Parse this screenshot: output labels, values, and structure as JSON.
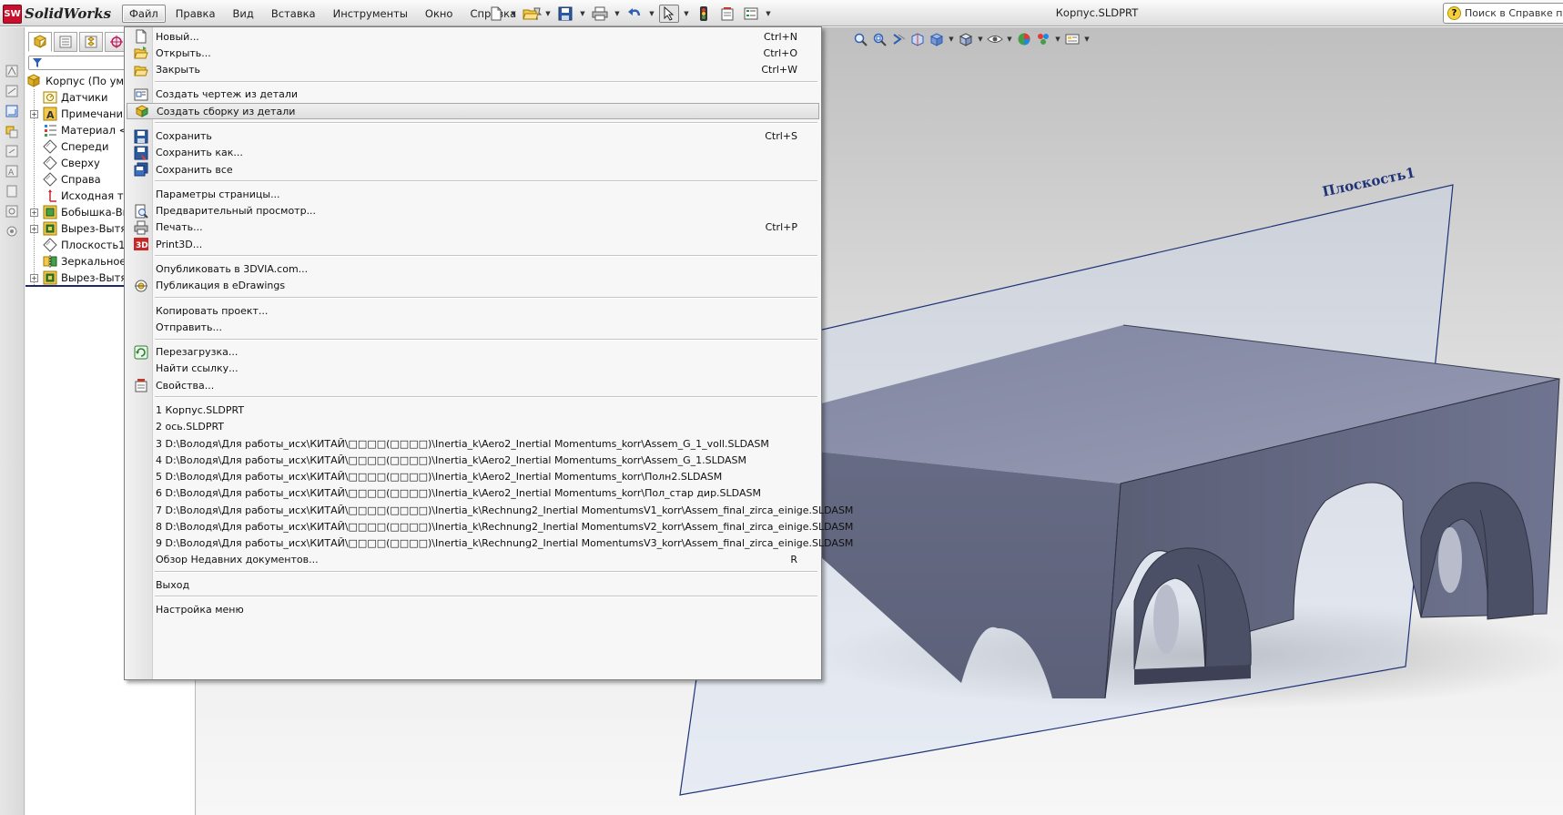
{
  "app": {
    "logo_text": "SolidWorks",
    "logo_mark": "SW",
    "document_title": "Корпус.SLDPRT",
    "help_search_placeholder": "Поиск в Справке по S"
  },
  "menubar": {
    "items": [
      "Файл",
      "Правка",
      "Вид",
      "Вставка",
      "Инструменты",
      "Окно",
      "Справка"
    ],
    "active": "Файл"
  },
  "feature_tree": {
    "root": "Корпус  (По умолч",
    "items": [
      {
        "label": "Датчики",
        "icon": "sensors-icon",
        "expandable": false
      },
      {
        "label": "Примечания",
        "icon": "annotations-icon",
        "expandable": true
      },
      {
        "label": "Материал <н",
        "icon": "material-icon",
        "expandable": false
      },
      {
        "label": "Спереди",
        "icon": "plane-icon",
        "expandable": false
      },
      {
        "label": "Сверху",
        "icon": "plane-icon",
        "expandable": false
      },
      {
        "label": "Справа",
        "icon": "plane-icon",
        "expandable": false
      },
      {
        "label": "Исходная точ",
        "icon": "origin-icon",
        "expandable": false
      },
      {
        "label": "Бобышка-Выт",
        "icon": "boss-extrude-icon",
        "expandable": true
      },
      {
        "label": "Вырез-Вытян",
        "icon": "cut-extrude-icon",
        "expandable": true
      },
      {
        "label": "Плоскость1",
        "icon": "plane-icon",
        "expandable": false
      },
      {
        "label": "Зеркальное о",
        "icon": "mirror-icon",
        "expandable": false
      },
      {
        "label": "Вырез-Вытян",
        "icon": "cut-extrude-icon",
        "expandable": true
      }
    ]
  },
  "graphics": {
    "plane_label": "Плоскость1"
  },
  "file_menu": {
    "items": [
      {
        "label": "Новый...",
        "shortcut": "Ctrl+N",
        "icon": "new-document-icon"
      },
      {
        "label": "Открыть...",
        "shortcut": "Ctrl+O",
        "icon": "open-folder-icon"
      },
      {
        "label": "Закрыть",
        "shortcut": "Ctrl+W",
        "icon": "close-folder-icon"
      },
      {
        "sep": true
      },
      {
        "label": "Создать чертеж из детали",
        "shortcut": "",
        "icon": "make-drawing-icon"
      },
      {
        "label": "Создать сборку из детали",
        "shortcut": "",
        "icon": "make-assembly-icon",
        "hover": true
      },
      {
        "sep": true
      },
      {
        "label": "Сохранить",
        "shortcut": "Ctrl+S",
        "icon": "save-icon"
      },
      {
        "label": "Сохранить как...",
        "shortcut": "",
        "icon": "save-as-icon"
      },
      {
        "label": "Сохранить все",
        "shortcut": "",
        "icon": "save-all-icon"
      },
      {
        "sep": true
      },
      {
        "label": "Параметры страницы...",
        "shortcut": "",
        "icon": ""
      },
      {
        "label": "Предварительный просмотр...",
        "shortcut": "",
        "icon": "print-preview-icon"
      },
      {
        "label": "Печать...",
        "shortcut": "Ctrl+P",
        "icon": "print-icon"
      },
      {
        "label": "Print3D...",
        "shortcut": "",
        "icon": "print3d-icon"
      },
      {
        "sep": true
      },
      {
        "label": "Опубликовать в 3DVIA.com...",
        "shortcut": "",
        "icon": ""
      },
      {
        "label": "Публикация в eDrawings",
        "shortcut": "",
        "icon": "edrawings-icon"
      },
      {
        "sep": true
      },
      {
        "label": "Копировать проект...",
        "shortcut": "",
        "icon": ""
      },
      {
        "label": "Отправить...",
        "shortcut": "",
        "icon": ""
      },
      {
        "sep": true
      },
      {
        "label": "Перезагрузка...",
        "shortcut": "",
        "icon": "reload-icon"
      },
      {
        "label": "Найти ссылку...",
        "shortcut": "",
        "icon": ""
      },
      {
        "label": "Свойства...",
        "shortcut": "",
        "icon": "properties-icon"
      },
      {
        "sep": true
      },
      {
        "label": "1 Корпус.SLDPRT",
        "shortcut": "",
        "icon": ""
      },
      {
        "label": "2 ось.SLDPRT",
        "shortcut": "",
        "icon": ""
      },
      {
        "label": "3 D:\\Володя\\Для работы_исх\\КИТАЙ\\□□□□(□□□□)\\Inertia_k\\Aero2_Inertial Momentums_korr\\Assem_G_1_voll.SLDASM",
        "shortcut": "",
        "icon": ""
      },
      {
        "label": "4 D:\\Володя\\Для работы_исх\\КИТАЙ\\□□□□(□□□□)\\Inertia_k\\Aero2_Inertial Momentums_korr\\Assem_G_1.SLDASM",
        "shortcut": "",
        "icon": ""
      },
      {
        "label": "5 D:\\Володя\\Для работы_исх\\КИТАЙ\\□□□□(□□□□)\\Inertia_k\\Aero2_Inertial Momentums_korr\\Полн2.SLDASM",
        "shortcut": "",
        "icon": ""
      },
      {
        "label": "6 D:\\Володя\\Для работы_исх\\КИТАЙ\\□□□□(□□□□)\\Inertia_k\\Aero2_Inertial Momentums_korr\\Пол_стар дир.SLDASM",
        "shortcut": "",
        "icon": ""
      },
      {
        "label": "7 D:\\Володя\\Для работы_исх\\КИТАЙ\\□□□□(□□□□)\\Inertia_k\\Rechnung2_Inertial MomentumsV1_korr\\Assem_final_zirca_einige.SLDASM",
        "shortcut": "",
        "icon": ""
      },
      {
        "label": "8 D:\\Володя\\Для работы_исх\\КИТАЙ\\□□□□(□□□□)\\Inertia_k\\Rechnung2_Inertial MomentumsV2_korr\\Assem_final_zirca_einige.SLDASM",
        "shortcut": "",
        "icon": ""
      },
      {
        "label": "9 D:\\Володя\\Для работы_исх\\КИТАЙ\\□□□□(□□□□)\\Inertia_k\\Rechnung2_Inertial MomentumsV3_korr\\Assem_final_zirca_einige.SLDASM",
        "shortcut": "",
        "icon": ""
      },
      {
        "label": "Обзор Недавних документов...",
        "shortcut": "R",
        "icon": ""
      },
      {
        "sep": true
      },
      {
        "label": "Выход",
        "shortcut": "",
        "icon": ""
      },
      {
        "sep": true
      },
      {
        "label": "Настройка меню",
        "shortcut": "",
        "icon": ""
      }
    ]
  },
  "colors": {
    "part_top": "#8a8faa",
    "part_front": "#6b7088",
    "part_side": "#5a5e74",
    "plane_edge": "#1f3377",
    "menu_hover": "#dedede"
  }
}
